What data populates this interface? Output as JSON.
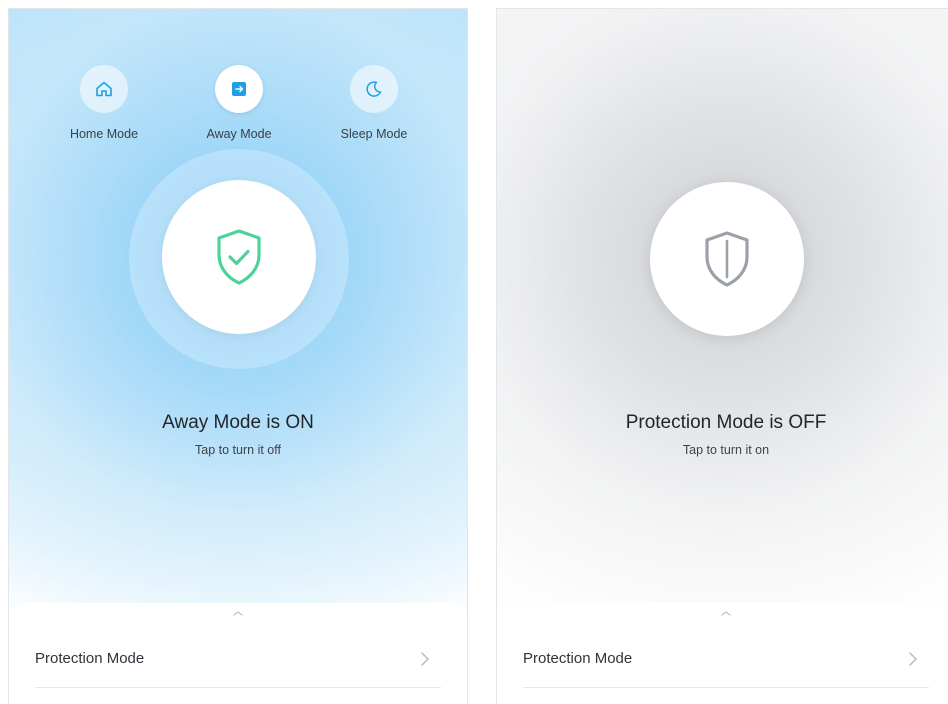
{
  "left": {
    "modes": [
      {
        "label": "Home Mode",
        "icon": "home-icon",
        "active": false
      },
      {
        "label": "Away Mode",
        "icon": "away-exit-icon",
        "active": true
      },
      {
        "label": "Sleep Mode",
        "icon": "moon-icon",
        "active": false
      }
    ],
    "status_title": "Away Mode is ON",
    "status_subtitle": "Tap to turn it off",
    "shield_icon": "shield-check-icon",
    "row_label": "Protection Mode"
  },
  "right": {
    "status_title": "Protection Mode is OFF",
    "status_subtitle": "Tap to turn it on",
    "shield_icon": "shield-off-icon",
    "row_label": "Protection Mode"
  },
  "colors": {
    "accent_blue": "#1ea0e6",
    "shield_green": "#4cd39a",
    "shield_gray": "#9ba1a8"
  }
}
